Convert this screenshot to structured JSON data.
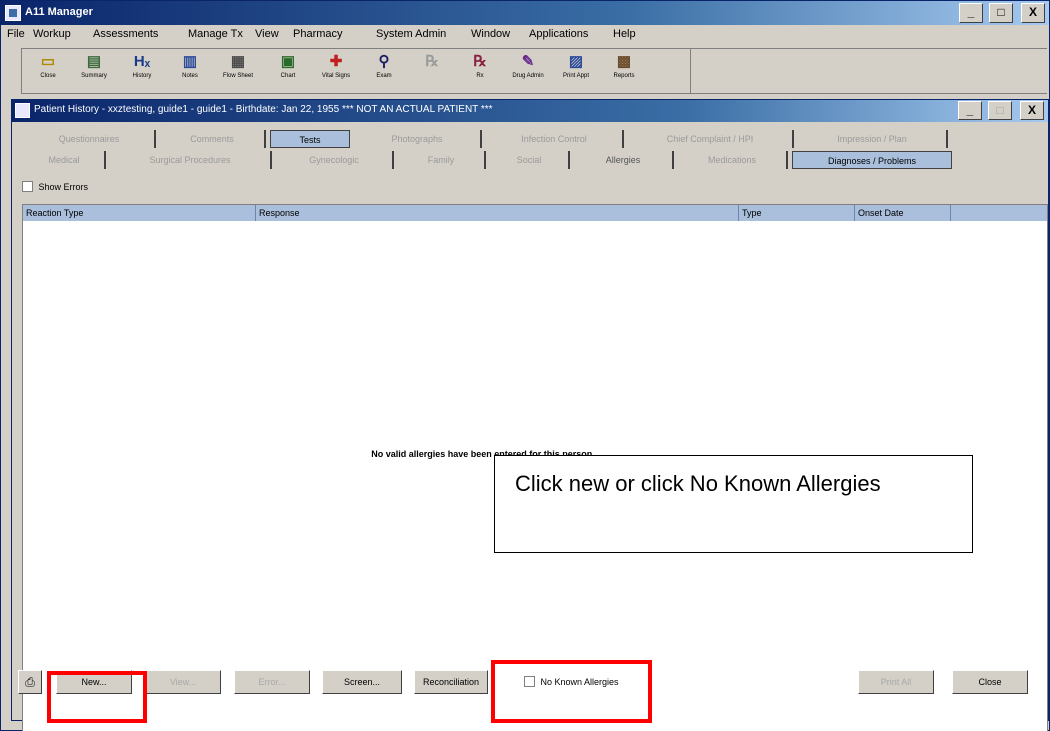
{
  "app": {
    "title": "A11 Manager",
    "window_buttons": {
      "minimize": "_",
      "maximize": "□",
      "close": "X"
    },
    "menu": [
      "File",
      "Workup",
      "Assessments",
      "Manage Tx",
      "View",
      "Pharmacy",
      "System Admin",
      "Window",
      "Applications",
      "Help"
    ],
    "toolbar": [
      {
        "label": "Close",
        "icon": "folder-icon",
        "glyph": "▭",
        "color": "#b08a00"
      },
      {
        "label": "Summary",
        "icon": "summary-icon",
        "glyph": "▤",
        "color": "#3a6a3a"
      },
      {
        "label": "History",
        "icon": "history-icon",
        "glyph": "Hₓ",
        "color": "#1a3a8a"
      },
      {
        "label": "Notes",
        "icon": "notes-icon",
        "glyph": "▥",
        "color": "#2a4a9a"
      },
      {
        "label": "Flow Sheet",
        "icon": "flowsheet-icon",
        "glyph": "▦",
        "color": "#4a4a4a"
      },
      {
        "label": "Chart",
        "icon": "chart-icon",
        "glyph": "▣",
        "color": "#2a6a2a"
      },
      {
        "label": "Vital Signs",
        "icon": "vitals-icon",
        "glyph": "✚",
        "color": "#c02020"
      },
      {
        "label": "Exam",
        "icon": "exam-icon",
        "glyph": "⚲",
        "color": "#20206a"
      },
      {
        "label": "",
        "icon": "disabled-tool-icon",
        "glyph": "℞",
        "color": "#9a9a9a"
      },
      {
        "label": "Rx",
        "icon": "rx-icon",
        "glyph": "℞",
        "color": "#8a2040"
      },
      {
        "label": "Drug Admin",
        "icon": "drug-admin-icon",
        "glyph": "✎",
        "color": "#6a2a8a"
      },
      {
        "label": "Print Appt",
        "icon": "print-appt-icon",
        "glyph": "▨",
        "color": "#2a4a9a"
      },
      {
        "label": "Reports",
        "icon": "reports-icon",
        "glyph": "▩",
        "color": "#6a4a2a"
      }
    ]
  },
  "child": {
    "title": "Patient History - xxztesting, guide1 - guide1 - Birthdate: Jan 22, 1955 *** NOT AN ACTUAL PATIENT ***",
    "tabs_row1": [
      "Questionnaires",
      "Comments",
      "Tests",
      "Photographs",
      "Infection Control",
      "Chief Complaint / HPI",
      "Impression / Plan"
    ],
    "tabs_row2": [
      "Medical",
      "Surgical Procedures",
      "Gynecologic",
      "Family",
      "Social",
      "Allergies",
      "Medications",
      "Diagnoses / Problems"
    ],
    "show_errors_label": "Show Errors",
    "columns": [
      "Reaction Type",
      "Response",
      "Type",
      "Onset Date"
    ],
    "empty_message": "No valid allergies have been entered for this person.",
    "buttons": {
      "new": "New...",
      "view": "View...",
      "error": "Error...",
      "screen": "Screen...",
      "reconciliation": "Reconciliation",
      "no_known_allergies": "No Known Allergies",
      "print_all": "Print All",
      "close": "Close"
    }
  },
  "annotation": {
    "callout_text": "Click new or click No Known Allergies",
    "highlight_color": "#ff0000"
  }
}
